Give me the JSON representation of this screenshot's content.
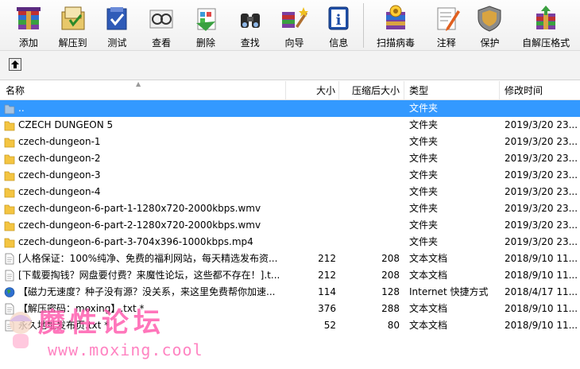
{
  "toolbar": {
    "buttons": [
      {
        "label": "添加",
        "icon": "add-archive-icon"
      },
      {
        "label": "解压到",
        "icon": "extract-to-icon"
      },
      {
        "label": "测试",
        "icon": "test-icon"
      },
      {
        "label": "查看",
        "icon": "view-icon"
      },
      {
        "label": "删除",
        "icon": "delete-icon"
      },
      {
        "label": "查找",
        "icon": "find-icon"
      },
      {
        "label": "向导",
        "icon": "wizard-icon"
      },
      {
        "label": "信息",
        "icon": "info-icon"
      },
      {
        "label": "扫描病毒",
        "icon": "virus-scan-icon"
      },
      {
        "label": "注释",
        "icon": "comment-icon"
      },
      {
        "label": "保护",
        "icon": "protect-icon"
      },
      {
        "label": "自解压格式",
        "icon": "sfx-icon"
      }
    ]
  },
  "columns": {
    "name": "名称",
    "size": "大小",
    "packed": "压缩后大小",
    "type": "类型",
    "modified": "修改时间"
  },
  "rows": [
    {
      "name": "..",
      "size": "",
      "packed": "",
      "type": "文件夹",
      "modified": "",
      "icon": "parent-folder-icon",
      "selected": true
    },
    {
      "name": "CZECH DUNGEON 5",
      "size": "",
      "packed": "",
      "type": "文件夹",
      "modified": "2019/3/20 23...",
      "icon": "folder-icon"
    },
    {
      "name": "czech-dungeon-1",
      "size": "",
      "packed": "",
      "type": "文件夹",
      "modified": "2019/3/20 23...",
      "icon": "folder-icon"
    },
    {
      "name": "czech-dungeon-2",
      "size": "",
      "packed": "",
      "type": "文件夹",
      "modified": "2019/3/20 23...",
      "icon": "folder-icon"
    },
    {
      "name": "czech-dungeon-3",
      "size": "",
      "packed": "",
      "type": "文件夹",
      "modified": "2019/3/20 23...",
      "icon": "folder-icon"
    },
    {
      "name": "czech-dungeon-4",
      "size": "",
      "packed": "",
      "type": "文件夹",
      "modified": "2019/3/20 23...",
      "icon": "folder-icon"
    },
    {
      "name": "czech-dungeon-6-part-1-1280x720-2000kbps.wmv",
      "size": "",
      "packed": "",
      "type": "文件夹",
      "modified": "2019/3/20 23...",
      "icon": "folder-icon"
    },
    {
      "name": "czech-dungeon-6-part-2-1280x720-2000kbps.wmv",
      "size": "",
      "packed": "",
      "type": "文件夹",
      "modified": "2019/3/20 23...",
      "icon": "folder-icon"
    },
    {
      "name": "czech-dungeon-6-part-3-704x396-1000kbps.mp4",
      "size": "",
      "packed": "",
      "type": "文件夹",
      "modified": "2019/3/20 23...",
      "icon": "folder-icon"
    },
    {
      "name": "[人格保证：100%纯净、免费的福利网站，每天精选发布资...",
      "size": "212",
      "packed": "208",
      "type": "文本文档",
      "modified": "2018/9/10 11...",
      "icon": "text-file-icon"
    },
    {
      "name": "[下载要掏钱？网盘要付费？来魔性论坛，这些都不存在！].t...",
      "size": "212",
      "packed": "208",
      "type": "文本文档",
      "modified": "2018/9/10 11...",
      "icon": "text-file-icon"
    },
    {
      "name": "【磁力无速度？种子没有源？没关系，来这里免费帮你加速...",
      "size": "114",
      "packed": "128",
      "type": "Internet 快捷方式",
      "modified": "2018/4/17 11...",
      "icon": "internet-shortcut-icon"
    },
    {
      "name": "【解压密码：moxing】.txt *",
      "size": "376",
      "packed": "288",
      "type": "文本文档",
      "modified": "2018/9/10 11...",
      "icon": "text-file-icon"
    },
    {
      "name": "永久地址发布页.txt *",
      "size": "52",
      "packed": "80",
      "type": "文本文档",
      "modified": "2018/9/10 11...",
      "icon": "text-file-icon"
    }
  ],
  "watermark": {
    "title": "魔性论坛",
    "url": "www.moxing.cool"
  },
  "colors": {
    "selection": "#3399ff",
    "folder": "#f4c542",
    "watermark": "#ff5fb0"
  }
}
